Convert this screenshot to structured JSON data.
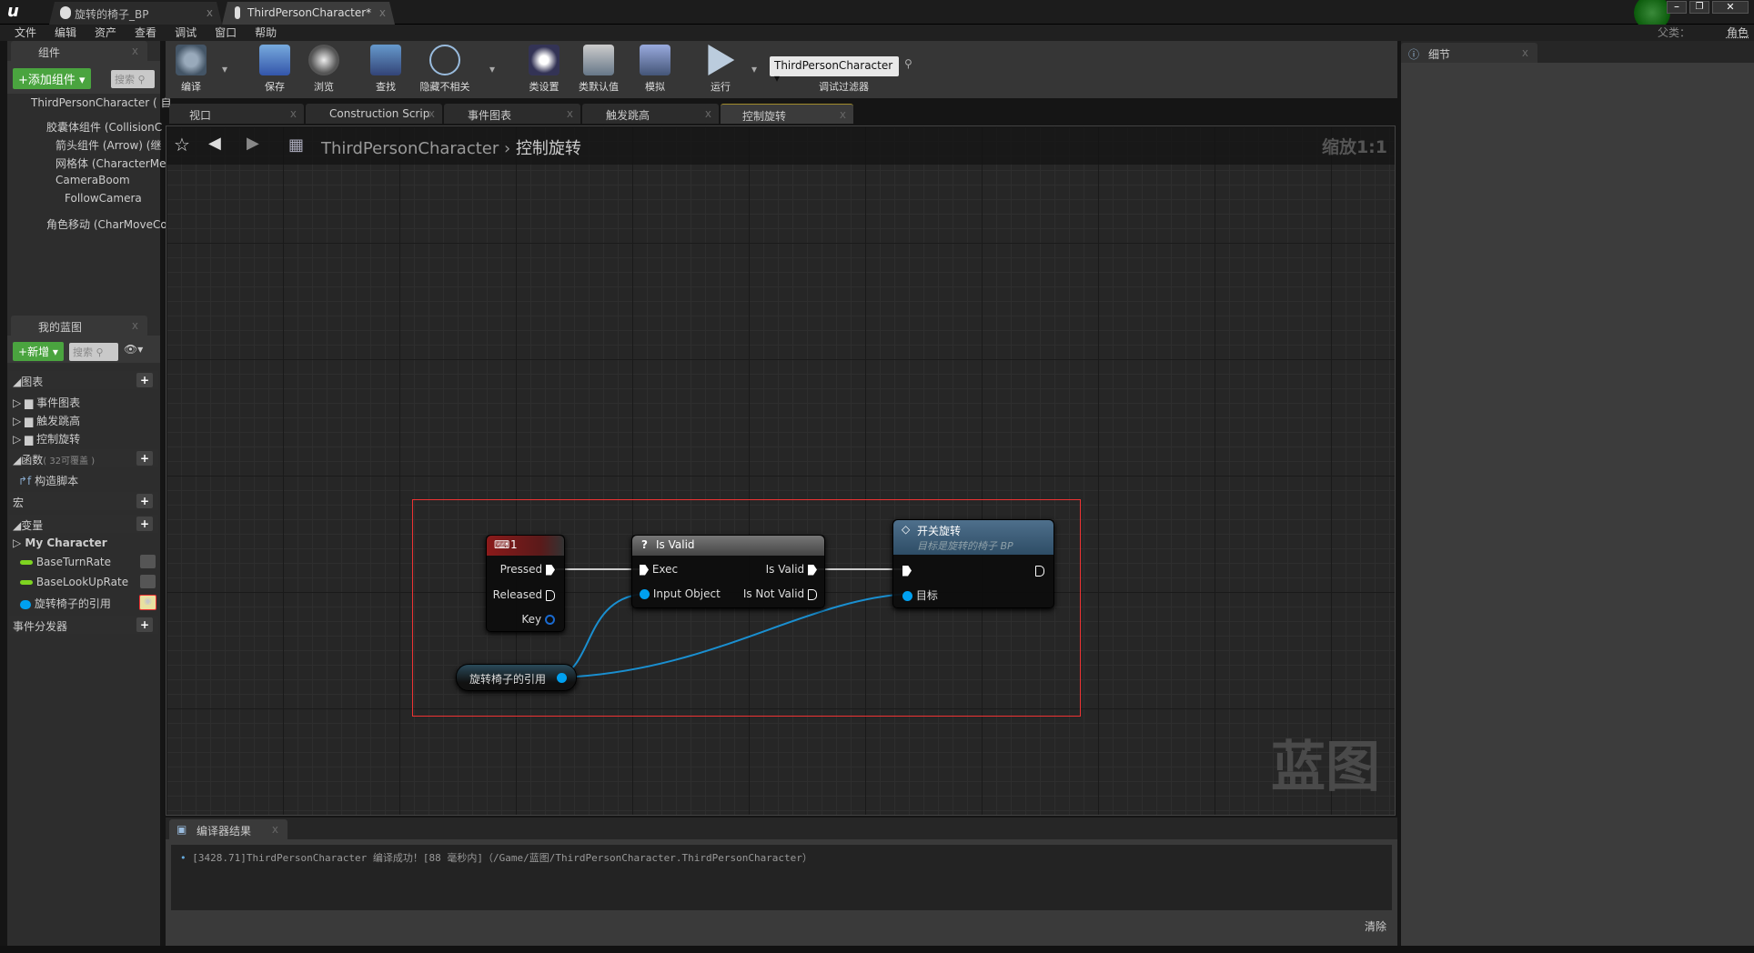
{
  "window": {
    "doc_tabs": [
      {
        "label": "旋转的椅子_BP"
      },
      {
        "label": "ThirdPersonCharacter*"
      }
    ],
    "parent_class_label": "父类：",
    "parent_class_value": "角色"
  },
  "menu": [
    "文件",
    "编辑",
    "资产",
    "查看",
    "调试",
    "窗口",
    "帮助"
  ],
  "components": {
    "tab": "组件",
    "add_button": "添加组件",
    "search_placeholder": "搜索",
    "tree": [
      "ThirdPersonCharacter ( 自",
      "胶囊体组件 (CollisionC",
      "箭头组件 (Arrow) (继",
      "网格体 (CharacterMe",
      "CameraBoom",
      "FollowCamera",
      "角色移动 (CharMoveCo"
    ]
  },
  "my_blueprint": {
    "tab": "我的蓝图",
    "new_button": "新增",
    "search_placeholder": "搜索",
    "graphs_section": "图表",
    "graphs": [
      "事件图表",
      "触发跳高",
      "控制旋转"
    ],
    "functions_section": "函数",
    "functions_note": "( 32可覆盖 )",
    "functions": [
      "构造脚本"
    ],
    "macros_section": "宏",
    "variables_section": "变量",
    "variable_category": "My Character",
    "variables": [
      {
        "name": "BaseTurnRate",
        "color": "#7ed321"
      },
      {
        "name": "BaseLookUpRate",
        "color": "#7ed321"
      },
      {
        "name": "旋转椅子的引用",
        "color": "#00a0f0"
      }
    ],
    "dispatchers_section": "事件分发器"
  },
  "toolbar": {
    "buttons": [
      "编译",
      "保存",
      "浏览",
      "查找",
      "隐藏不相关",
      "类设置",
      "类默认值",
      "模拟",
      "运行"
    ],
    "debug_select": "ThirdPersonCharacter",
    "debug_label": "调试过滤器"
  },
  "graph_tabs": [
    {
      "label": "视口"
    },
    {
      "label": "Construction Scrip"
    },
    {
      "label": "事件图表"
    },
    {
      "label": "触发跳高"
    },
    {
      "label": "控制旋转",
      "active": true
    }
  ],
  "breadcrumb": {
    "root": "ThirdPersonCharacter",
    "current": "控制旋转",
    "zoom": "缩放1:1"
  },
  "watermark": "蓝图",
  "nodes": {
    "key_event": {
      "title": "1",
      "pins": [
        "Pressed",
        "Released",
        "Key"
      ],
      "color": "#8b1a1a"
    },
    "is_valid": {
      "title": "Is Valid",
      "inputs": [
        "Exec",
        "Input Object"
      ],
      "outputs": [
        "Is Valid",
        "Is Not Valid"
      ]
    },
    "toggle": {
      "title": "开关旋转",
      "subtitle": "目标是旋转的椅子 BP",
      "target_pin": "目标"
    },
    "variable": {
      "label": "旋转椅子的引用"
    }
  },
  "compiler": {
    "tab": "编译器结果",
    "message": "[3428.71]ThirdPersonCharacter 编译成功！[88 毫秒内]（/Game/蓝图/ThirdPersonCharacter.ThirdPersonCharacter）",
    "clear_button": "清除"
  },
  "details": {
    "tab": "细节"
  }
}
